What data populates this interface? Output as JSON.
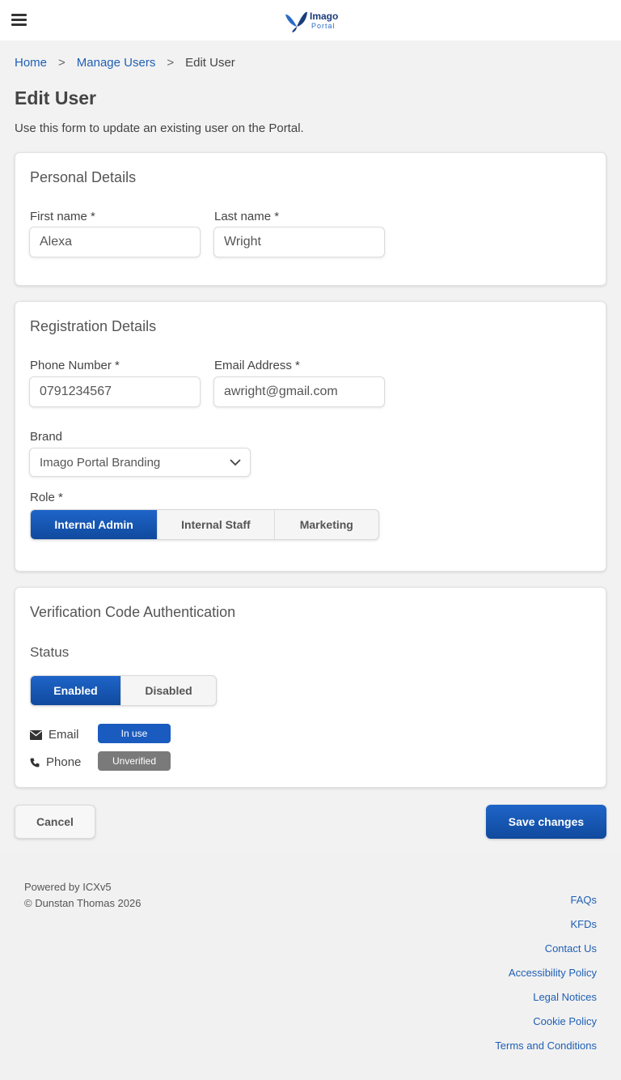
{
  "header": {
    "logo_title": "Imago",
    "logo_subtitle": "Portal"
  },
  "breadcrumb": {
    "home": "Home",
    "sep1": ">",
    "manage_users": "Manage Users",
    "sep2": ">",
    "current": "Edit User"
  },
  "page": {
    "title": "Edit User",
    "intro": "Use this form to update an existing user on the Portal."
  },
  "personal": {
    "title": "Personal Details",
    "first_name_label": "First name *",
    "first_name_value": "Alexa",
    "last_name_label": "Last name *",
    "last_name_value": "Wright"
  },
  "registration": {
    "title": "Registration Details",
    "phone_label": "Phone Number *",
    "phone_value": "0791234567",
    "email_label": "Email Address *",
    "email_value": "awright@gmail.com",
    "brand_label": "Brand",
    "brand_value": "Imago Portal Branding",
    "role_label": "Role *",
    "roles": [
      "Internal Admin",
      "Internal Staff",
      "Marketing"
    ],
    "selected_role": "Internal Admin"
  },
  "verification": {
    "title": "Verification Code Authentication",
    "status_label": "Status",
    "status_options": [
      "Enabled",
      "Disabled"
    ],
    "selected_status": "Enabled",
    "email_label": "Email",
    "email_badge": "In use",
    "phone_label": "Phone",
    "phone_badge": "Unverified"
  },
  "actions": {
    "cancel": "Cancel",
    "save": "Save changes"
  },
  "footer": {
    "powered": "Powered by ICXv5",
    "copyright": "© Dunstan Thomas 2026",
    "links": [
      "FAQs",
      "KFDs",
      "Contact Us",
      "Accessibility Policy",
      "Legal Notices",
      "Cookie Policy",
      "Terms and Conditions"
    ]
  },
  "colors": {
    "primary": "#1a5bbf",
    "link": "#1f5fb5",
    "badge_in_use": "#1a5bbf",
    "badge_unverified": "#7a7a7a"
  }
}
